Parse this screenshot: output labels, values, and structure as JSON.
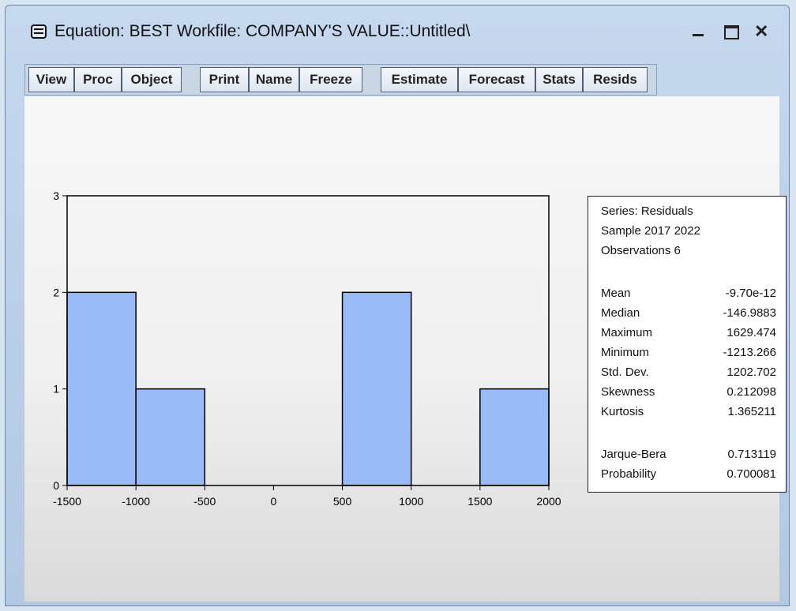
{
  "window": {
    "title": "Equation: BEST   Workfile: COMPANY'S VALUE::Untitled\\",
    "controls": {
      "minimize_icon": "minimize-icon",
      "maximize_icon": "maximize-icon",
      "close_icon": "close-icon"
    }
  },
  "toolbar": {
    "groups": [
      [
        "View",
        "Proc",
        "Object"
      ],
      [
        "Print",
        "Name",
        "Freeze"
      ],
      [
        "Estimate",
        "Forecast",
        "Stats",
        "Resids"
      ]
    ]
  },
  "chart_data": {
    "type": "bar",
    "x": [
      -1500,
      -1000,
      -500,
      0,
      500,
      1000,
      1500,
      2000
    ],
    "bins": [
      {
        "from": -1500,
        "to": -1000,
        "count": 2
      },
      {
        "from": -1000,
        "to": -500,
        "count": 1
      },
      {
        "from": -500,
        "to": 0,
        "count": 0
      },
      {
        "from": 0,
        "to": 500,
        "count": 0
      },
      {
        "from": 500,
        "to": 1000,
        "count": 2
      },
      {
        "from": 1000,
        "to": 1500,
        "count": 0
      },
      {
        "from": 1500,
        "to": 2000,
        "count": 1
      }
    ],
    "xticks": [
      "-1500",
      "-1000",
      "-500",
      "0",
      "500",
      "1000",
      "1500",
      "2000"
    ],
    "yticks": [
      "0",
      "1",
      "2",
      "3"
    ],
    "xlim": [
      -1500,
      2000
    ],
    "ylim": [
      0,
      3
    ],
    "bar_color": "#99bbf7",
    "grid": false
  },
  "stats": {
    "header": [
      "Series: Residuals",
      "Sample 2017 2022",
      "Observations 6"
    ],
    "rows": [
      {
        "label": "Mean",
        "value": "-9.70e-12"
      },
      {
        "label": "Median",
        "value": "-146.9883"
      },
      {
        "label": "Maximum",
        "value": "1629.474"
      },
      {
        "label": "Minimum",
        "value": "-1213.266"
      },
      {
        "label": "Std. Dev.",
        "value": "1202.702"
      },
      {
        "label": "Skewness",
        "value": "0.212098"
      },
      {
        "label": "Kurtosis",
        "value": "1.365211"
      }
    ],
    "tests": [
      {
        "label": "Jarque-Bera",
        "value": "0.713119"
      },
      {
        "label": "Probability",
        "value": "0.700081"
      }
    ]
  }
}
